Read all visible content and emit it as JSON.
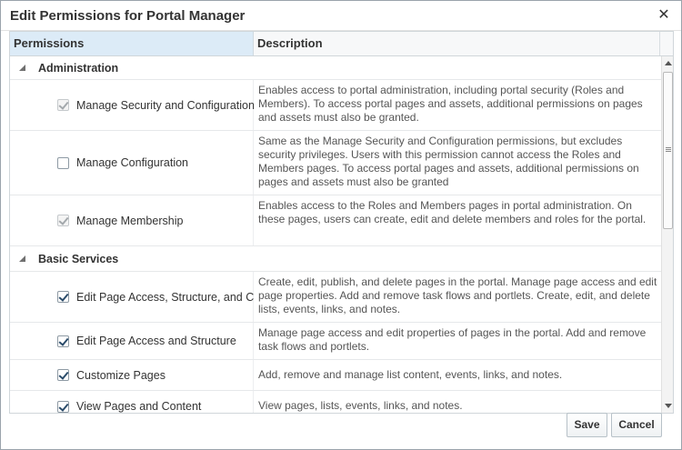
{
  "dialog": {
    "title": "Edit Permissions for Portal Manager",
    "close_glyph": "✕"
  },
  "table": {
    "headers": {
      "permissions": "Permissions",
      "description": "Description"
    },
    "groups": [
      {
        "label": "Administration",
        "items": [
          {
            "label": "Manage Security and Configuration",
            "checked": true,
            "disabled": true,
            "description": "Enables access to portal administration, including portal security (Roles and Members). To access portal pages and assets, additional permissions on pages and assets must also be granted."
          },
          {
            "label": "Manage Configuration",
            "checked": false,
            "disabled": false,
            "description": "Same as the Manage Security and Configuration permissions, but excludes security privileges. Users with this permission cannot access the Roles and Members pages. To access portal pages and assets, additional permissions on pages and assets must also be granted"
          },
          {
            "label": "Manage Membership",
            "checked": true,
            "disabled": true,
            "description": "Enables access to the Roles and Members pages in portal administration. On these pages, users can create, edit and delete members and roles for the portal."
          }
        ]
      },
      {
        "label": "Basic Services",
        "items": [
          {
            "label": "Edit Page Access, Structure, and C",
            "checked": true,
            "disabled": false,
            "description": "Create, edit, publish, and delete pages in the portal. Manage page access and edit page properties. Add and remove task flows and portlets. Create, edit, and delete lists, events, links, and notes."
          },
          {
            "label": "Edit Page Access and Structure",
            "checked": true,
            "disabled": false,
            "description": "Manage page access and edit properties of pages in the portal. Add and remove task flows and portlets."
          },
          {
            "label": "Customize Pages",
            "checked": true,
            "disabled": false,
            "description": "Add, remove and manage list content, events, links, and notes."
          },
          {
            "label": "View Pages and Content",
            "checked": true,
            "disabled": false,
            "description": "View pages, lists, events, links, and notes."
          }
        ]
      }
    ]
  },
  "buttons": {
    "save": "Save",
    "cancel": "Cancel"
  }
}
